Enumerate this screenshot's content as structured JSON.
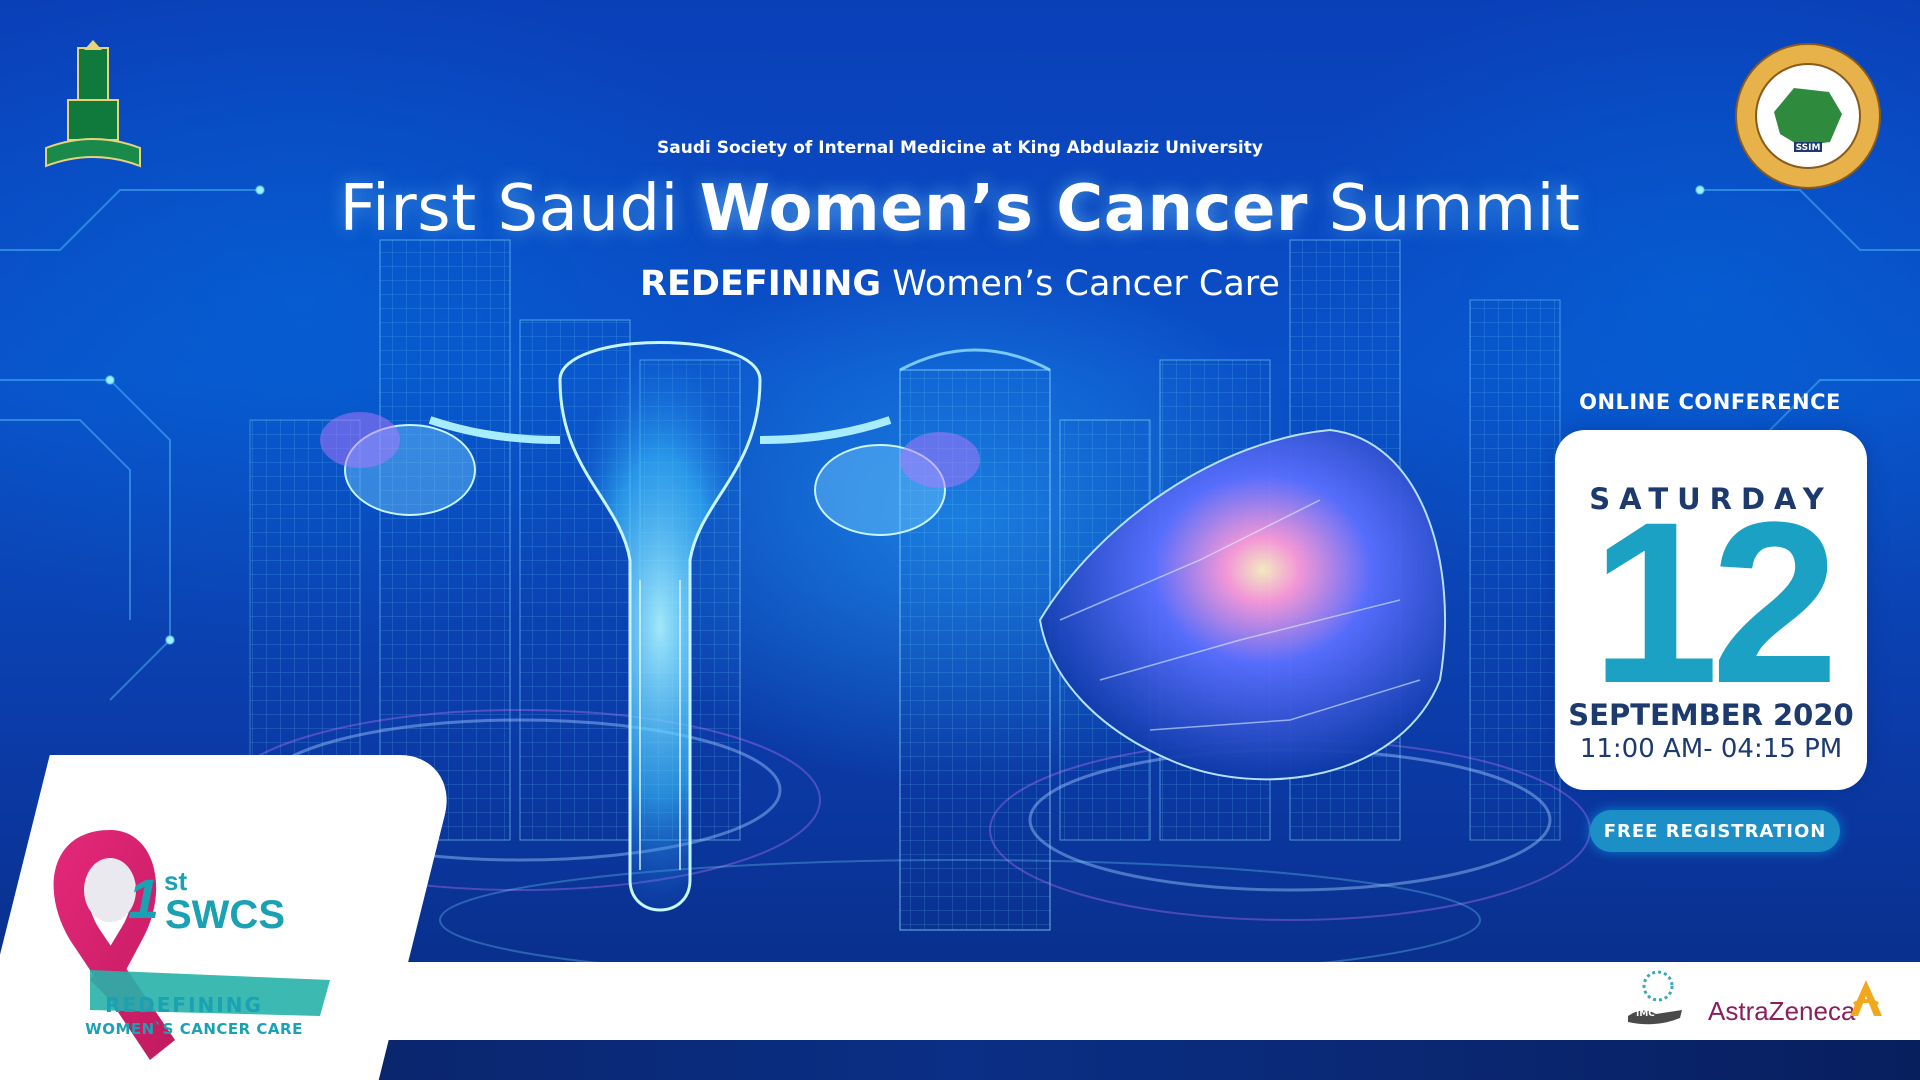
{
  "organizer": {
    "line": "Saudi Society of Internal Medicine at King Abdulaziz University"
  },
  "title": {
    "prefix": "First Saudi",
    "emphasis": "Women’s Cancer",
    "suffix": "Summit"
  },
  "subtitle": {
    "emphasis": "REDEFINING",
    "rest": "Women’s Cancer Care"
  },
  "event": {
    "format": "ONLINE CONFERENCE",
    "weekday": "SATURDAY",
    "day": "12",
    "month_year": "SEPTEMBER 2020",
    "time": "11:00 AM- 04:15 PM",
    "registration": "FREE REGISTRATION"
  },
  "swcs_logo": {
    "ordinal_number": "1",
    "ordinal_suffix": "st",
    "acronym": "SWCS",
    "tagline_1": "REDEFINING",
    "tagline_2": "WOMEN`S CANCER CARE"
  },
  "logos": {
    "kau": "king-abdulaziz-university-logo",
    "ssim": "saudi-society-internal-medicine-logo",
    "ssim_mark": "SSIM",
    "imc_mark": "IMC",
    "sponsor": "AstraZeneca"
  },
  "colors": {
    "background_blue": "#0a50c8",
    "accent_teal": "#1aa1c4",
    "navy_text": "#1c3a6e",
    "ribbon_pink": "#e5287a",
    "sponsor_purple": "#8a1f5e",
    "sponsor_gold": "#f2a81d"
  }
}
